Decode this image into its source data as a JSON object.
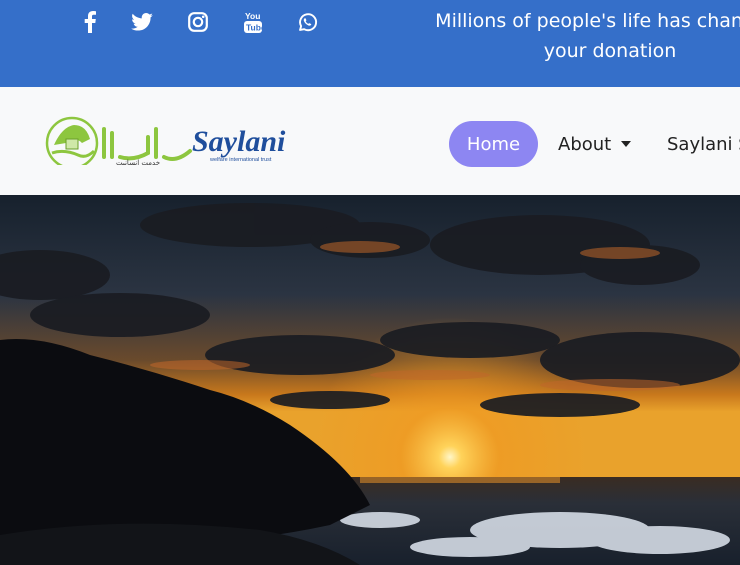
{
  "topbar": {
    "social": [
      {
        "icon": "facebook-icon"
      },
      {
        "icon": "twitter-icon"
      },
      {
        "icon": "instagram-icon"
      },
      {
        "icon": "youtube-icon"
      },
      {
        "icon": "whatsapp-icon"
      }
    ],
    "marquee_line1": "Millions of people's life has changed,",
    "marquee_line2": "your donation"
  },
  "navbar": {
    "logo_text": "Saylani",
    "logo_urdu": "سیلانی",
    "logo_tagline": "welfare international trust",
    "items": [
      {
        "label": "Home"
      },
      {
        "label": "About"
      },
      {
        "label": "Saylani Se"
      }
    ]
  },
  "colors": {
    "topbar": "#356fc9",
    "home_pill": "#8d86f2",
    "logo_green": "#8dc63f",
    "logo_blue": "#1f4e9c"
  },
  "hero": {
    "image": "sunset-over-ocean"
  }
}
